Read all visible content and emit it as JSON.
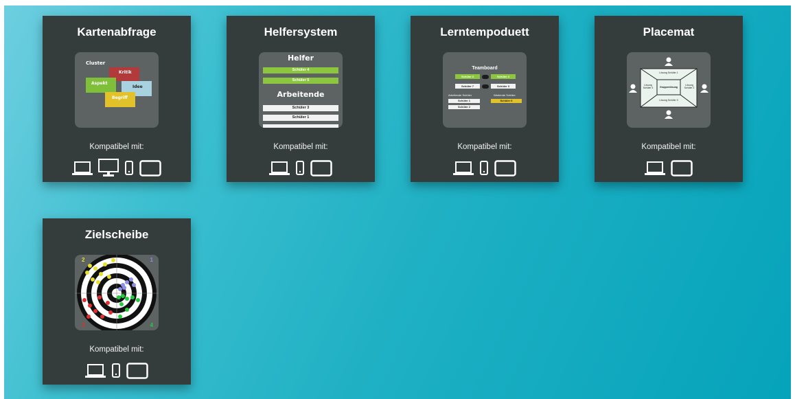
{
  "cards": [
    {
      "title": "Kartenabfrage",
      "compat": "Kompatibel mit:",
      "devices": [
        "laptop-icon",
        "monitor-icon",
        "phone-icon",
        "tablet-icon"
      ],
      "thumb": {
        "label": "Cluster",
        "cards": [
          "Kritik",
          "Aspekt",
          "Idee",
          "Begriff"
        ]
      }
    },
    {
      "title": "Helfersystem",
      "compat": "Kompatibel mit:",
      "devices": [
        "laptop-icon",
        "phone-icon",
        "tablet-icon"
      ],
      "thumb": {
        "heading1": "Helfer",
        "helpers": [
          "Schüler 4",
          "Schüler 5"
        ],
        "heading2": "Arbeitende",
        "workers": [
          "Schüler 3",
          "Schüler 1"
        ]
      }
    },
    {
      "title": "Lerntempoduett",
      "compat": "Kompatibel mit:",
      "devices": [
        "laptop-icon",
        "phone-icon",
        "tablet-icon"
      ],
      "thumb": {
        "heading": "Teamboard",
        "pair1": [
          "Schüler 3",
          "Schüler 4"
        ],
        "pair2": [
          "Schüler 7",
          "Schüler 3"
        ],
        "col1": "Arbeitende Schüler",
        "col2": "Wartende Schüler",
        "working": [
          "Schüler 1",
          "Schüler 2"
        ],
        "waiting": [
          "Schüler 6"
        ]
      }
    },
    {
      "title": "Placemat",
      "compat": "Kompatibel mit:",
      "devices": [
        "laptop-icon",
        "tablet-icon"
      ],
      "thumb": {
        "top": "Lösung Schüler 1",
        "left": "Lösung Schüler 4",
        "center": "Gruppenlösung",
        "right": "Lösung Schüler 2",
        "bottom": "Lösung Schüler 3"
      }
    },
    {
      "title": "Zielscheibe",
      "compat": "Kompatibel mit:",
      "devices": [
        "laptop-icon",
        "phone-icon",
        "tablet-icon"
      ],
      "thumb": {
        "q1": "2",
        "q2": "1",
        "q3": "3",
        "q4": "4"
      }
    }
  ]
}
